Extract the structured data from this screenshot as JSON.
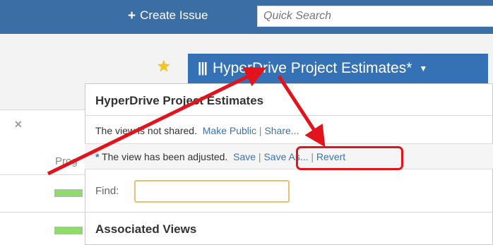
{
  "header": {
    "create_issue_label": "Create Issue",
    "search_placeholder": "Quick Search"
  },
  "view": {
    "button_label": "HyperDrive Project Estimates*"
  },
  "dropdown": {
    "title": "HyperDrive Project Estimates",
    "share_status": "The view is not shared.",
    "make_public_label": "Make Public",
    "share_label": "Share...",
    "adjusted_text": "The view has been adjusted.",
    "save_label": "Save",
    "save_as_label": "Save As...",
    "revert_label": "Revert",
    "find_label": "Find:",
    "find_value": "",
    "associated_views_label": "Associated Views"
  },
  "table": {
    "column_partial": "Prog"
  },
  "colors": {
    "header_bg": "#3a6ea5",
    "view_button_bg": "#3571b5",
    "link": "#3b73af",
    "annotation": "#e3131b",
    "progress": "#8fdc6b"
  }
}
